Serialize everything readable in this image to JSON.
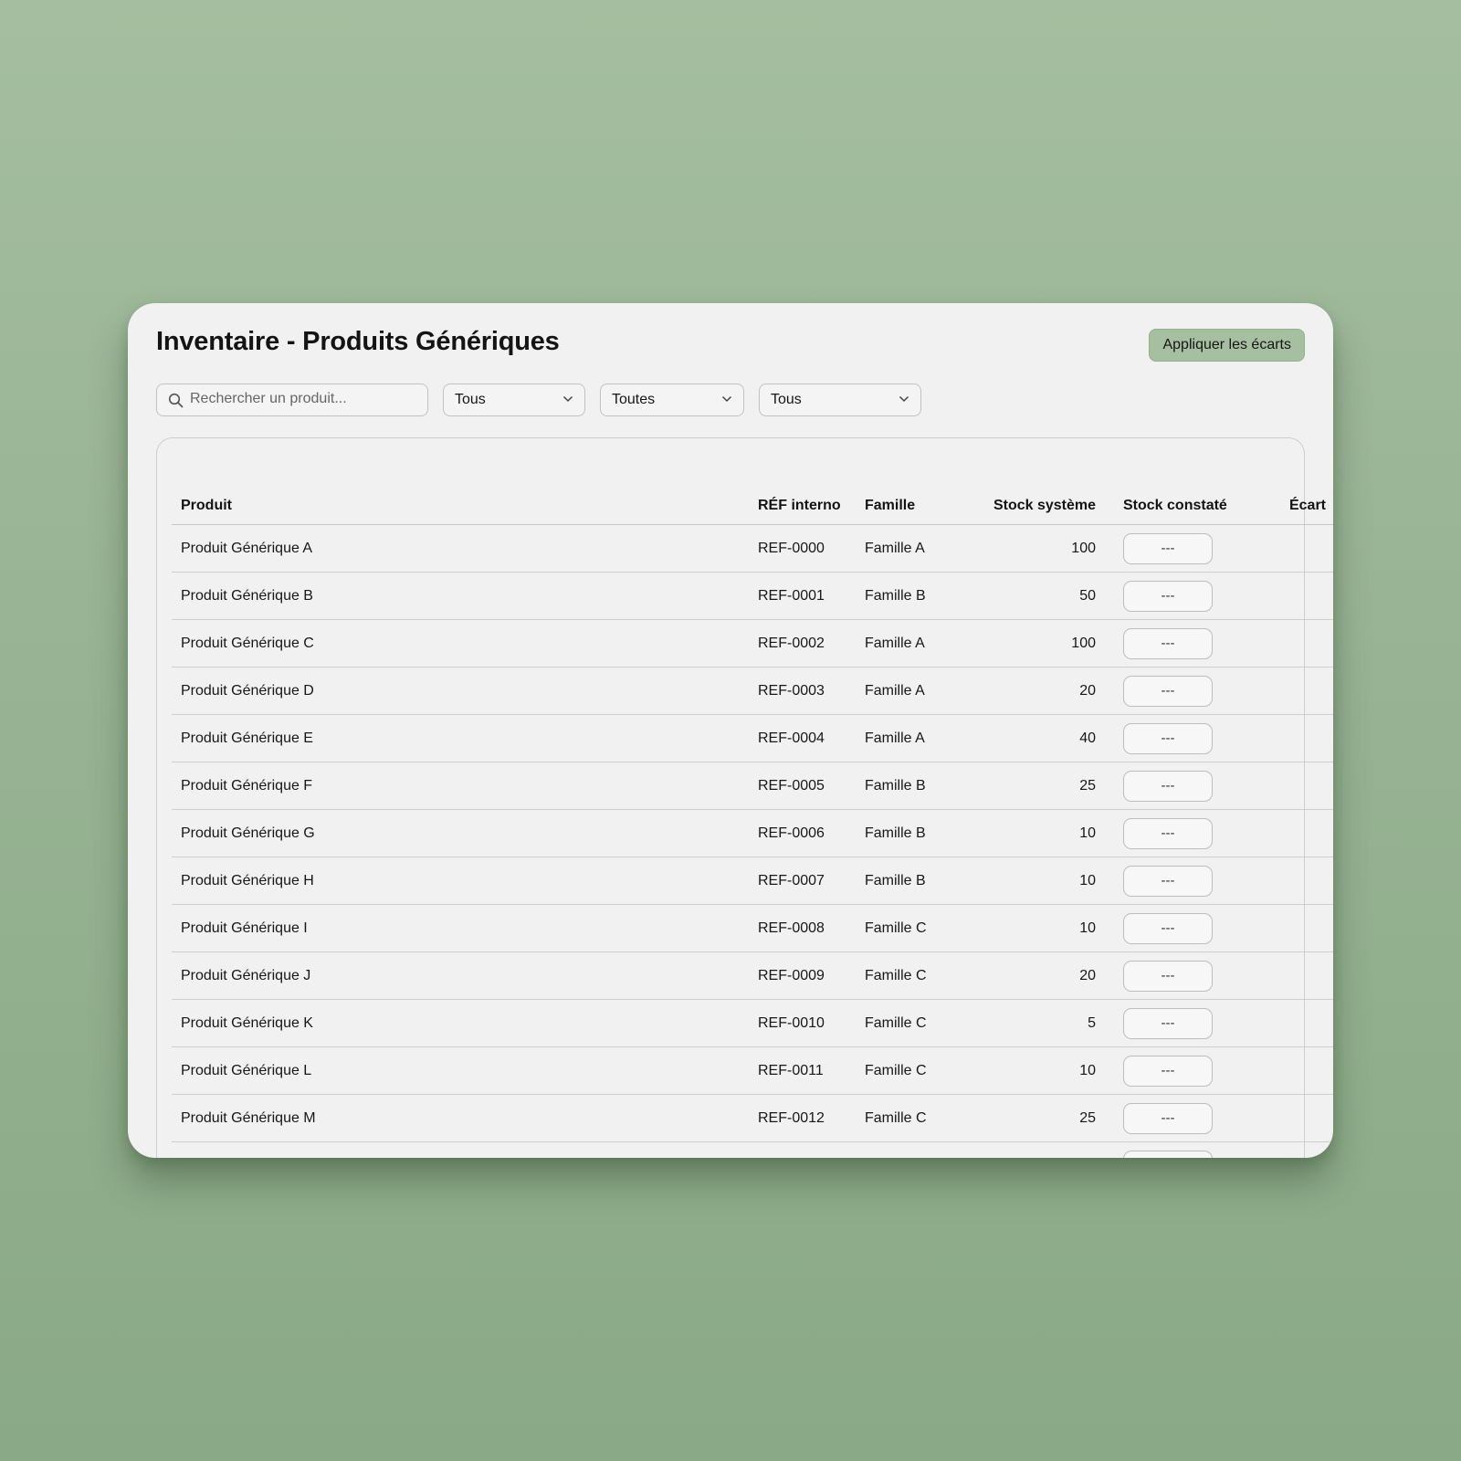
{
  "page": {
    "title": "Inventaire - Produits Génériques",
    "apply_label": "Appliquer les écarts"
  },
  "filters": {
    "search_placeholder": "Rechercher un produit...",
    "select1_value": "Tous",
    "select2_value": "Toutes",
    "select3_value": "Tous"
  },
  "table": {
    "headers": {
      "produit": "Produit",
      "ref": "RÉF interno",
      "famille": "Famille",
      "stock_systeme": "Stock système",
      "stock_constate": "Stock constaté",
      "ecart": "Écart"
    },
    "rows": [
      {
        "produit": "Produit Générique A",
        "ref": "REF-0000",
        "famille": "Famille A",
        "stock": "100",
        "constate": "",
        "ecart": ""
      },
      {
        "produit": "Produit Générique B",
        "ref": "REF-0001",
        "famille": "Famille B",
        "stock": "50",
        "constate": "",
        "ecart": ""
      },
      {
        "produit": "Produit Générique C",
        "ref": "REF-0002",
        "famille": "Famille A",
        "stock": "100",
        "constate": "",
        "ecart": ""
      },
      {
        "produit": "Produit Générique D",
        "ref": "REF-0003",
        "famille": "Famille A",
        "stock": "20",
        "constate": "",
        "ecart": ""
      },
      {
        "produit": "Produit Générique E",
        "ref": "REF-0004",
        "famille": "Famille A",
        "stock": "40",
        "constate": "",
        "ecart": ""
      },
      {
        "produit": "Produit Générique F",
        "ref": "REF-0005",
        "famille": "Famille B",
        "stock": "25",
        "constate": "",
        "ecart": ""
      },
      {
        "produit": "Produit Générique G",
        "ref": "REF-0006",
        "famille": "Famille B",
        "stock": "10",
        "constate": "",
        "ecart": ""
      },
      {
        "produit": "Produit Générique H",
        "ref": "REF-0007",
        "famille": "Famille B",
        "stock": "10",
        "constate": "",
        "ecart": ""
      },
      {
        "produit": "Produit Générique I",
        "ref": "REF-0008",
        "famille": "Famille C",
        "stock": "10",
        "constate": "",
        "ecart": ""
      },
      {
        "produit": "Produit Générique J",
        "ref": "REF-0009",
        "famille": "Famille C",
        "stock": "20",
        "constate": "",
        "ecart": ""
      },
      {
        "produit": "Produit Générique K",
        "ref": "REF-0010",
        "famille": "Famille C",
        "stock": "5",
        "constate": "",
        "ecart": ""
      },
      {
        "produit": "Produit Générique L",
        "ref": "REF-0011",
        "famille": "Famille C",
        "stock": "10",
        "constate": "",
        "ecart": ""
      },
      {
        "produit": "Produit Générique M",
        "ref": "REF-0012",
        "famille": "Famille C",
        "stock": "25",
        "constate": "",
        "ecart": ""
      },
      {
        "produit": "",
        "ref": "",
        "famille": "",
        "stock": "",
        "constate": "",
        "ecart": ""
      }
    ],
    "count_placeholder": "---"
  },
  "colors": {
    "background": "#9bb796",
    "card": "#f1f1f1",
    "accent_button": "#a6bfa0",
    "border": "#c2c2c2"
  },
  "icons": {
    "search": "search-icon",
    "dropdown": "chevron-down-icon"
  }
}
